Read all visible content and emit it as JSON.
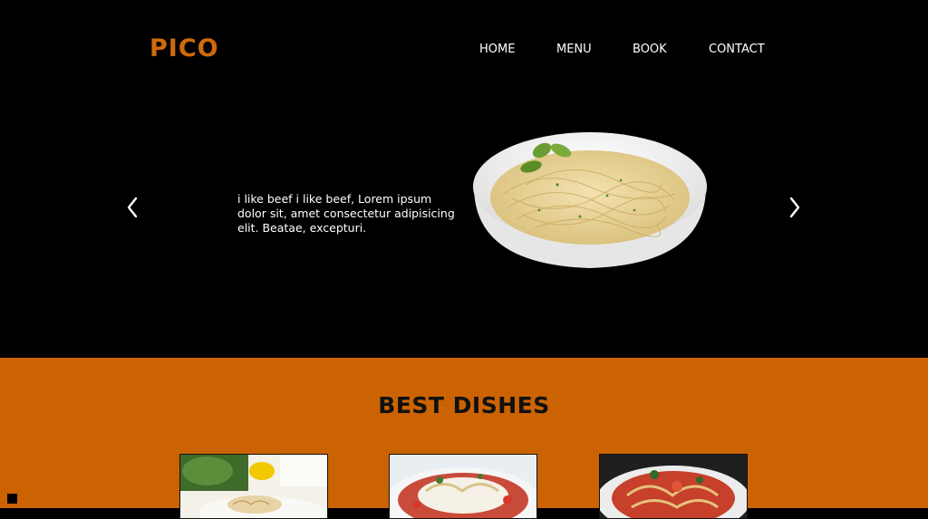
{
  "header": {
    "logo": "PICO",
    "nav": [
      "HOME",
      "MENU",
      "BOOK",
      "CONTACT"
    ]
  },
  "hero": {
    "text": "i like beef i like beef, Lorem ipsum dolor sit, amet consectetur adipisicing elit. Beatae, excepturi.",
    "prev_icon": "chevron-left-icon",
    "next_icon": "chevron-right-icon"
  },
  "best_dishes": {
    "title": "BEST DISHES",
    "cards": [
      "dish-photo-1",
      "dish-photo-2",
      "dish-photo-3"
    ]
  },
  "colors": {
    "accent": "#cc6303",
    "logo": "#d06a0a",
    "background": "#000000"
  }
}
